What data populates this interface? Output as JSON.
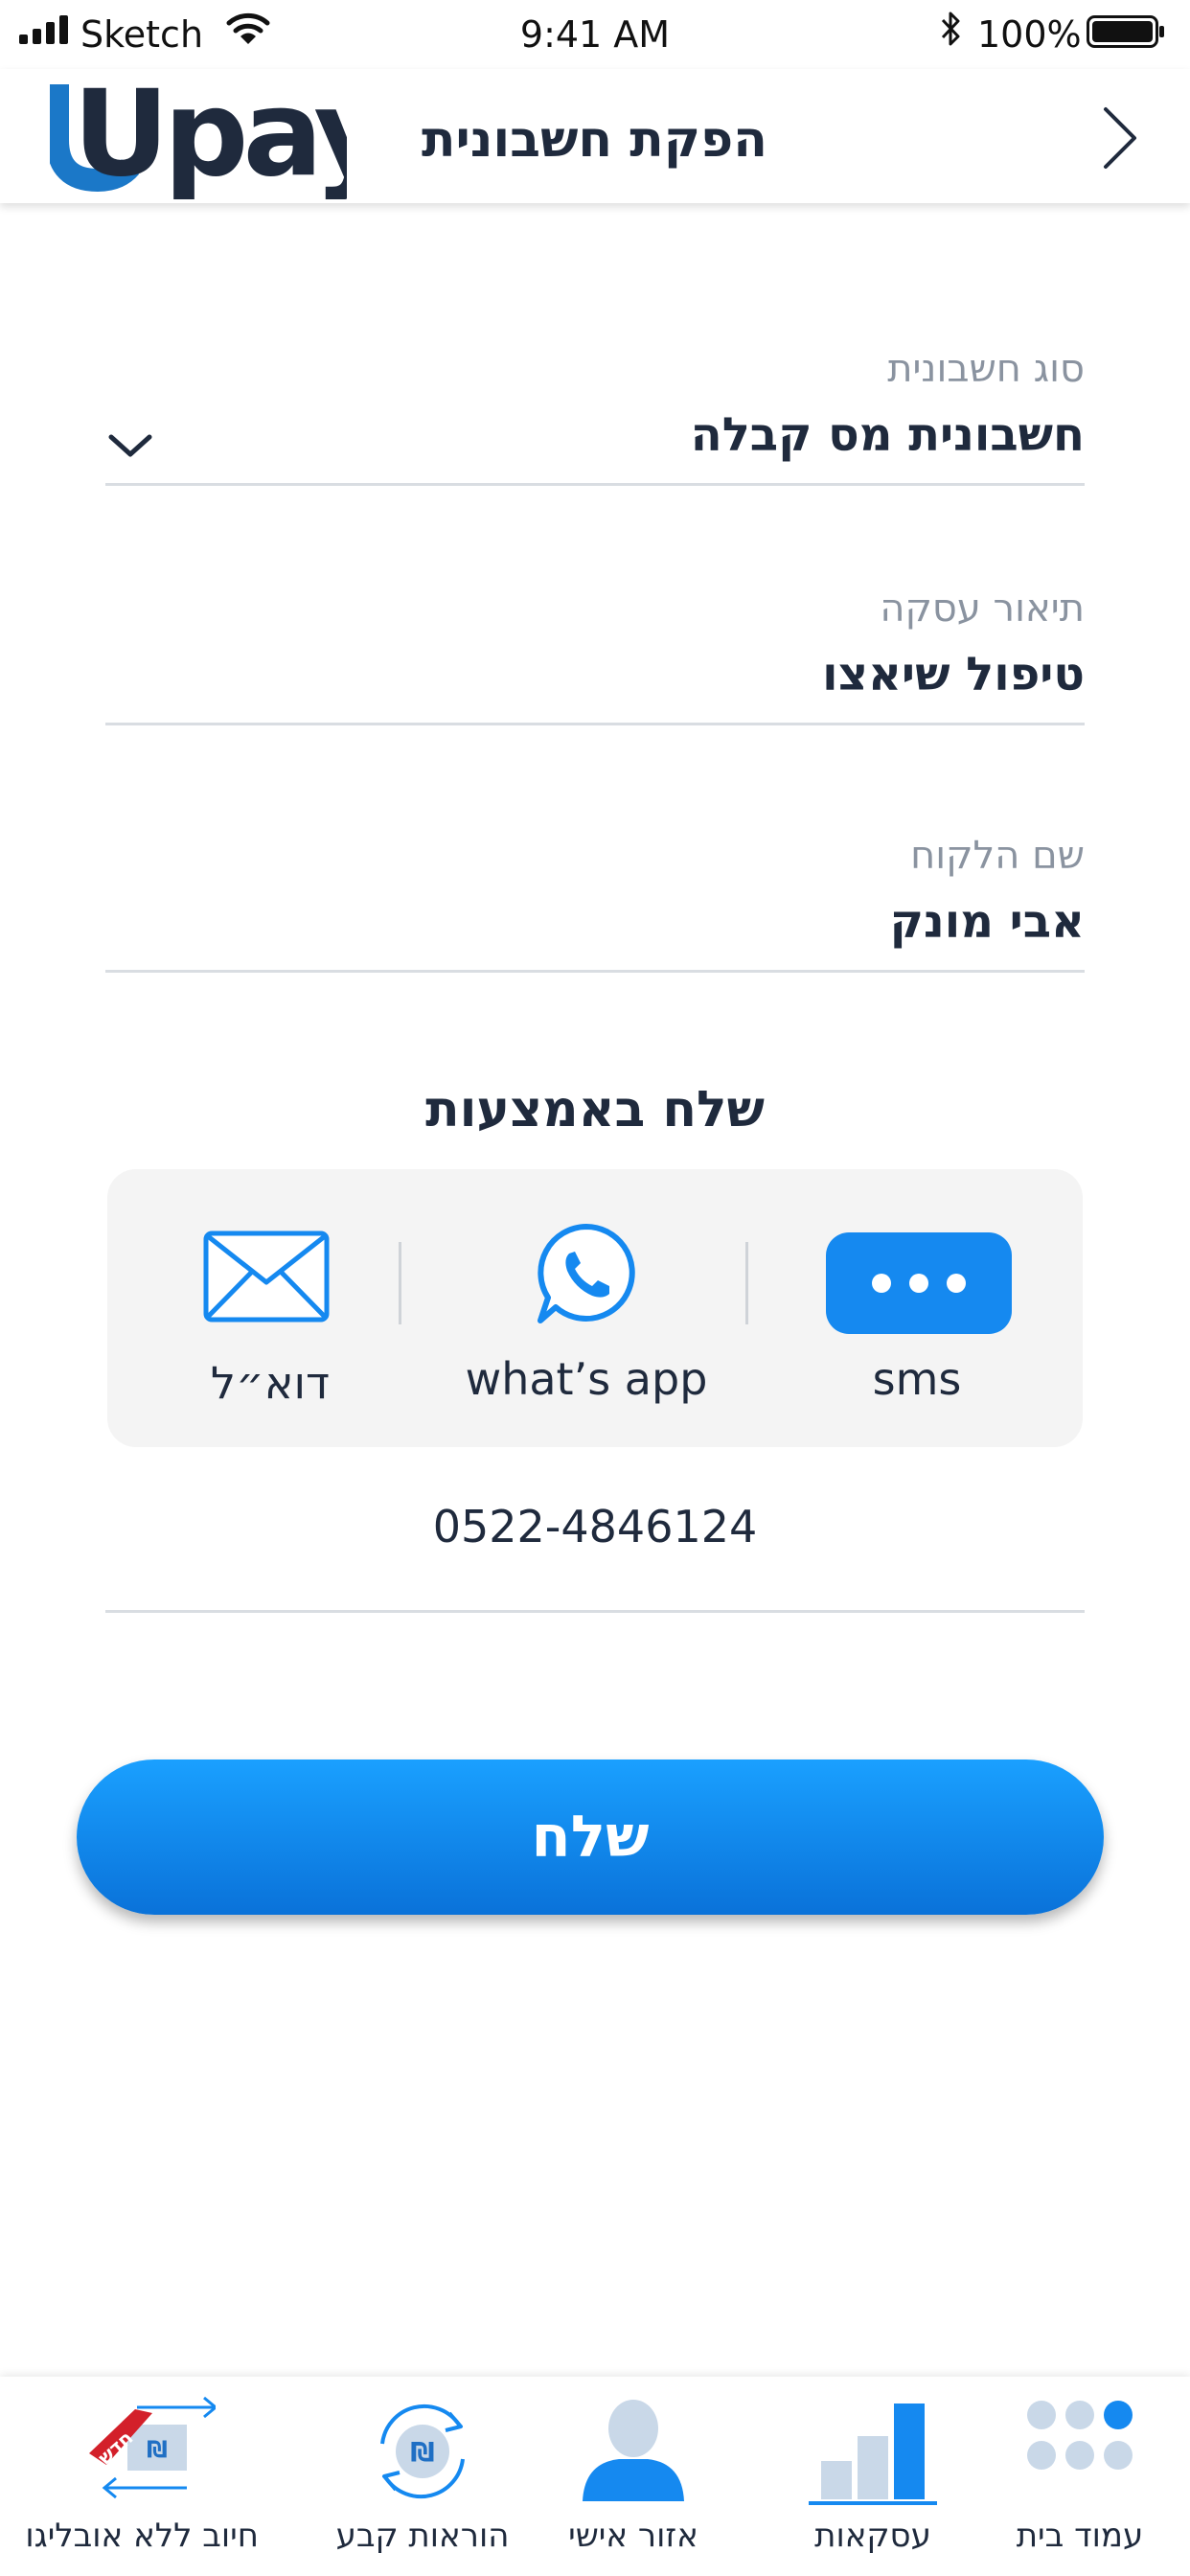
{
  "status_bar": {
    "carrier": "Sketch",
    "time": "9:41 AM",
    "battery": "100%"
  },
  "header": {
    "title": "הפקת חשבונית",
    "logo_text": "Upay"
  },
  "form": {
    "invoice_type": {
      "label": "סוג חשבונית",
      "value": "חשבונית מס קבלה"
    },
    "description": {
      "label": "תיאור עסקה",
      "value": "טיפול שיאצו"
    },
    "customer": {
      "label": "שם הלקוח",
      "value": "אבי מונק"
    }
  },
  "send_via": {
    "title": "שלח באמצעות",
    "channels": [
      {
        "label": "sms",
        "icon": "sms-bubble-icon"
      },
      {
        "label": "what’s app",
        "icon": "whatsapp-icon"
      },
      {
        "label": "דוא״ל",
        "icon": "envelope-icon"
      }
    ],
    "selected": "sms",
    "phone": "0522-4846124"
  },
  "send_button": {
    "label": "שלח"
  },
  "tab_bar": {
    "tabs": [
      {
        "label": "עמוד בית",
        "icon": "home-dots-icon"
      },
      {
        "label": "עסקאות",
        "icon": "bar-chart-icon",
        "active": true
      },
      {
        "label": "אזור אישי",
        "icon": "user-icon"
      },
      {
        "label": "הוראות קבע",
        "icon": "recurring-shekel-icon"
      },
      {
        "label": "חיוב ללא אובליגו",
        "icon": "card-transfer-icon",
        "badge": "חדש"
      }
    ]
  },
  "colors": {
    "accent": "#1589f0",
    "text": "#1f2a3d",
    "muted": "#8a93a0",
    "panel": "#f4f4f4",
    "logo_dark": "#1f2a3d",
    "logo_blue": "#1b78c8",
    "badge_red": "#d3202a"
  }
}
